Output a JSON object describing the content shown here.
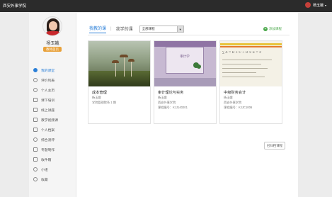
{
  "header": {
    "brand": "西安外事学院",
    "username": "杨玉娥"
  },
  "profile": {
    "name": "杨玉娥",
    "role_badge": "教师首页"
  },
  "nav": [
    {
      "label": "我的课堂",
      "icon": "classroom-icon",
      "active": true
    },
    {
      "label": "评价列表",
      "icon": "review-icon"
    },
    {
      "label": "个人主页",
      "icon": "home-icon"
    },
    {
      "label": "课下培训",
      "icon": "training-icon"
    },
    {
      "label": "线上讲座",
      "icon": "lecture-icon"
    },
    {
      "label": "教学视频课",
      "icon": "video-icon"
    },
    {
      "label": "个人档案",
      "icon": "archive-icon"
    },
    {
      "label": "综合测评",
      "icon": "evaluation-icon"
    },
    {
      "label": "专题制作",
      "icon": "topic-icon"
    },
    {
      "label": "收件箱",
      "icon": "inbox-icon"
    },
    {
      "label": "小组",
      "icon": "group-icon"
    },
    {
      "label": "收藏",
      "icon": "favorite-icon"
    }
  ],
  "tabs": {
    "teach": "我教的课",
    "study": "我学的课"
  },
  "term_select": {
    "value": "全部课程"
  },
  "add_course": "添加课程",
  "courses": [
    {
      "title": "成本管理",
      "teacher": "杨玉娥",
      "line2": "学院管理院系 1 期"
    },
    {
      "title": "审计理论与实务",
      "teacher": "杨玉娥",
      "line2": "西安外事学院",
      "line3": "课程编号：KJJ140201"
    },
    {
      "title": "中级财务会计",
      "teacher": "杨玉娥",
      "line2": "西安外事学院",
      "line3": "课程编号：KJJC1006"
    }
  ],
  "thumb_texts": {
    "audit_cover": "审计学",
    "accounting_formula": "∑ A = B + C ÷ D × E = F"
  },
  "done_button": "已归档课程"
}
